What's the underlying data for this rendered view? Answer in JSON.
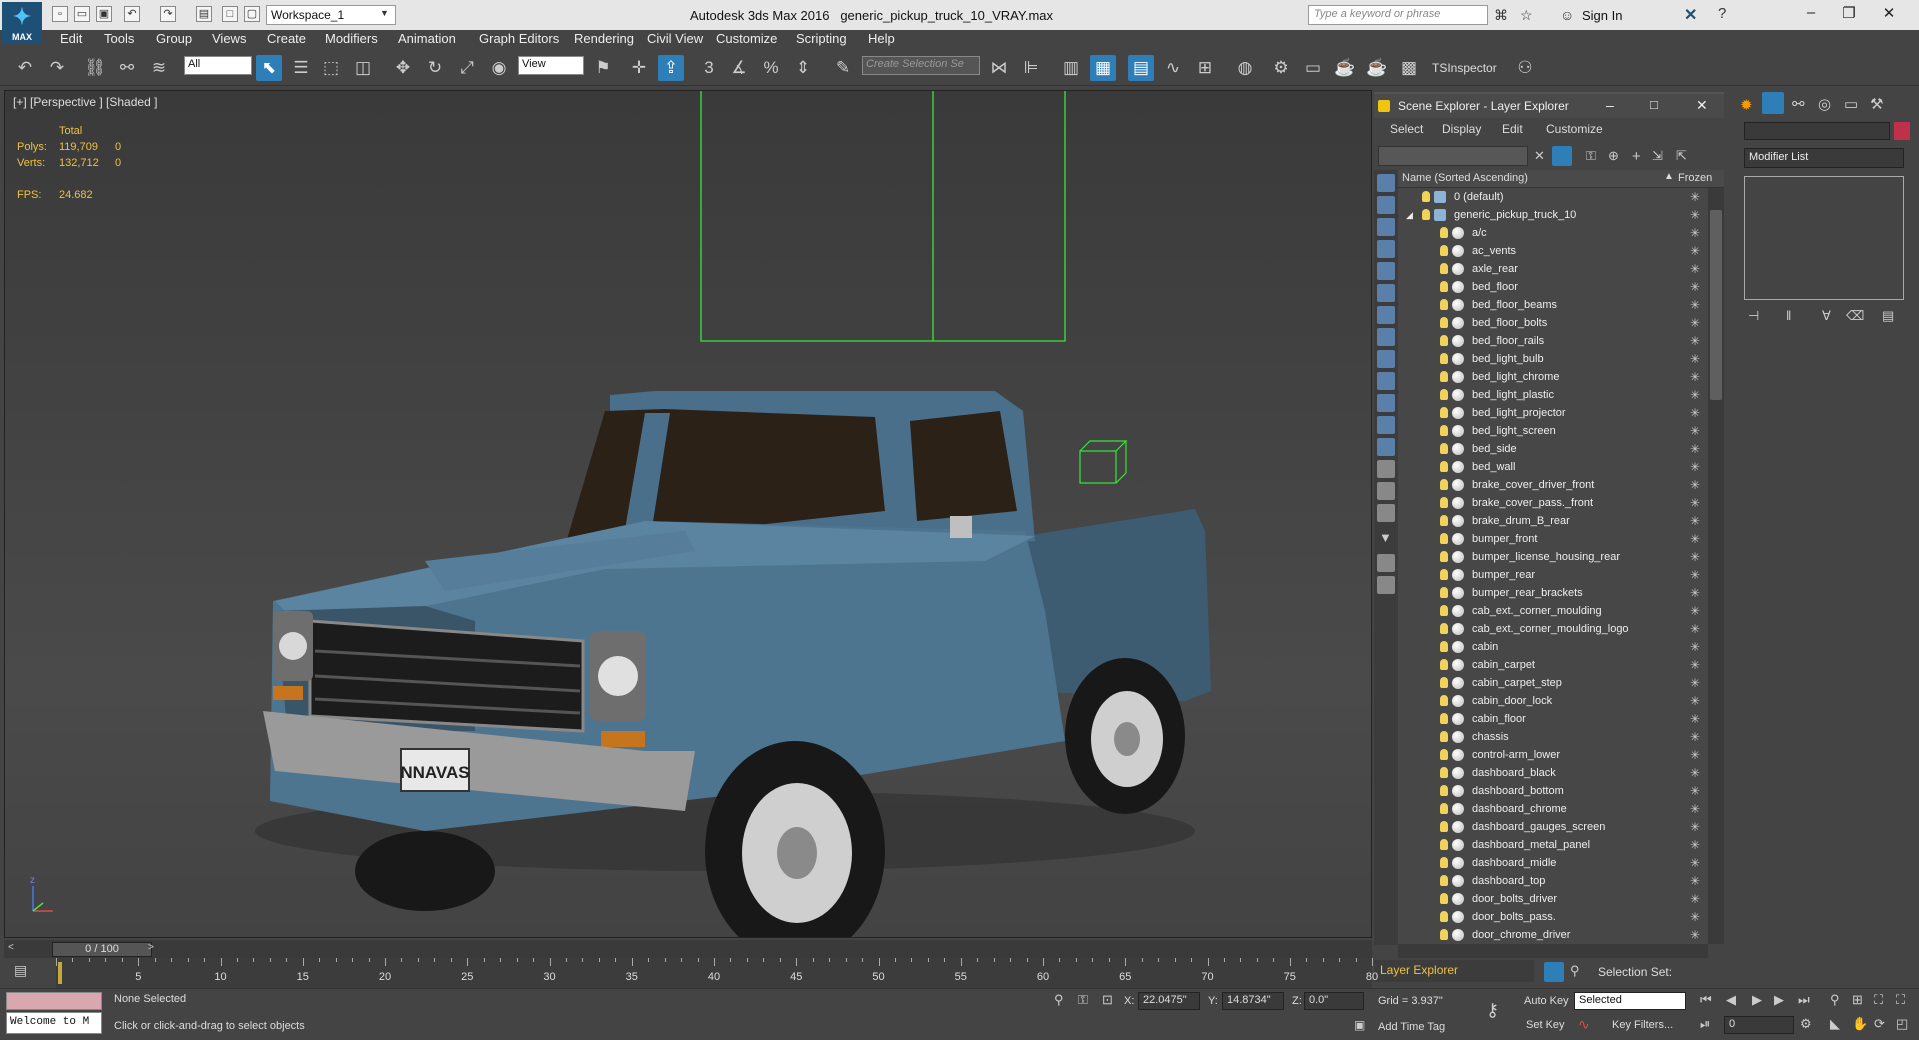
{
  "app": {
    "title": "Autodesk 3ds Max 2016",
    "file": "generic_pickup_truck_10_VRAY.max",
    "logo_label": "MAX",
    "workspace": "Workspace_1",
    "search_placeholder": "Type a keyword or phrase",
    "signin": "Sign In"
  },
  "menu": [
    "Edit",
    "Tools",
    "Group",
    "Views",
    "Create",
    "Modifiers",
    "Animation",
    "Graph Editors",
    "Rendering",
    "Civil View",
    "Customize",
    "Scripting",
    "Help"
  ],
  "toolbar": {
    "filter": "All",
    "ref_coord": "View",
    "snap_label": "3",
    "selection_set_placeholder": "Create Selection Se",
    "tsinspector": "TSInspector"
  },
  "viewport": {
    "label": "[+] [Perspective ] [Shaded ]",
    "stats": {
      "total_label": "Total",
      "polys_label": "Polys:",
      "polys": "119,709",
      "polys_sel": "0",
      "verts_label": "Verts:",
      "verts": "132,712",
      "verts_sel": "0",
      "fps_label": "FPS:",
      "fps": "24.682"
    },
    "plate": "NNAVAS",
    "axis_label": "z"
  },
  "scene_explorer": {
    "title": "Scene Explorer - Layer Explorer",
    "menu": [
      "Select",
      "Display",
      "Edit",
      "Customize"
    ],
    "col_name": "Name (Sorted Ascending)",
    "col_frozen": "Frozen",
    "layers": [
      "0 (default)",
      "generic_pickup_truck_10"
    ],
    "objects": [
      "a/c",
      "ac_vents",
      "axle_rear",
      "bed_floor",
      "bed_floor_beams",
      "bed_floor_bolts",
      "bed_floor_rails",
      "bed_light_bulb",
      "bed_light_chrome",
      "bed_light_plastic",
      "bed_light_projector",
      "bed_light_screen",
      "bed_side",
      "bed_wall",
      "brake_cover_driver_front",
      "brake_cover_pass._front",
      "brake_drum_B_rear",
      "bumper_front",
      "bumper_license_housing_rear",
      "bumper_rear",
      "bumper_rear_brackets",
      "cab_ext._corner_moulding",
      "cab_ext._corner_moulding_logo",
      "cabin",
      "cabin_carpet",
      "cabin_carpet_step",
      "cabin_door_lock",
      "cabin_floor",
      "chassis",
      "control-arm_lower",
      "dashboard_black",
      "dashboard_bottom",
      "dashboard_chrome",
      "dashboard_gauges_screen",
      "dashboard_metal_panel",
      "dashboard_midle",
      "dashboard_top",
      "door_bolts_driver",
      "door_bolts_pass.",
      "door_chrome_driver"
    ],
    "footer": "Layer Explorer",
    "selection_set": "Selection Set:"
  },
  "command_panel": {
    "modifier_list": "Modifier List"
  },
  "timeline": {
    "frame": "0 / 100",
    "ticks": [
      "5",
      "10",
      "15",
      "20",
      "25",
      "30",
      "35",
      "40",
      "45",
      "50",
      "55",
      "60",
      "65",
      "70",
      "75",
      "80"
    ]
  },
  "status": {
    "welcome": "Welcome to M",
    "selection": "None Selected",
    "prompt": "Click or click-and-drag to select objects",
    "x_label": "X:",
    "x": "22.0475\"",
    "y_label": "Y:",
    "y": "14.8734\"",
    "z_label": "Z:",
    "z": "0.0\"",
    "grid": "Grid = 3.937\"",
    "add_time_tag": "Add Time Tag",
    "auto_key": "Auto Key",
    "set_key": "Set Key",
    "key_mode": "Selected",
    "key_filters": "Key Filters...",
    "frame_field": "0"
  },
  "colors": {
    "accent": "#2e7fb8",
    "stats": "#f0c040",
    "truck": "#4a6f8a",
    "helper": "#39e639"
  }
}
